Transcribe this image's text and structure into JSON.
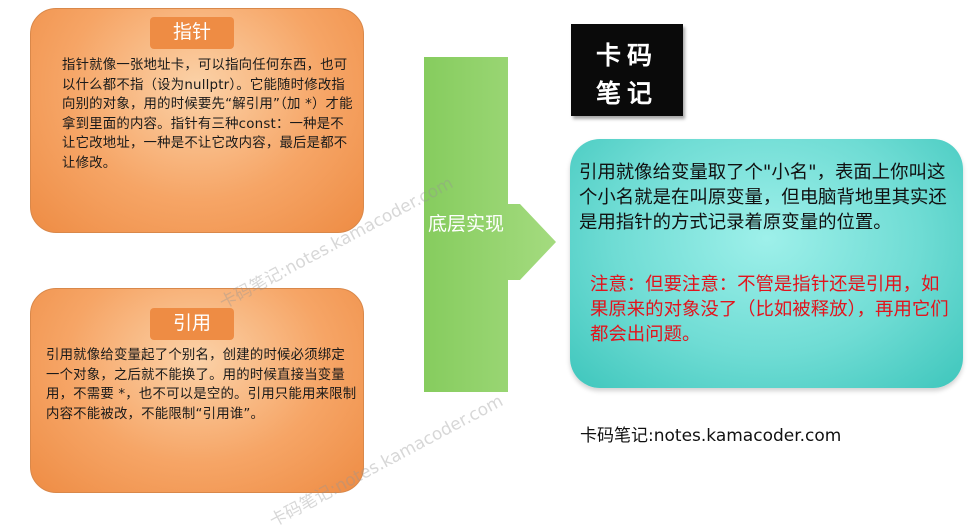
{
  "pointer": {
    "title": "指针",
    "description": "指针就像一张地址卡，可以指向任何东西，也可以什么都不指（设为nullptr）。它能随时修改指向别的对象，用的时候要先“解引用”（加 *）才能拿到里面的内容。指针有三种const：一种是不让它改地址，一种是不让它改内容，最后是都不让修改。"
  },
  "reference": {
    "title": "引用",
    "description": "引用就像给变量起了个别名，创建的时候必须绑定一个对象，之后就不能换了。用的时候直接当变量用，不需要 *，也不可以是空的。引用只能用来限制内容不能被改，不能限制“引用谁”。"
  },
  "arrow": {
    "label": "底层实现",
    "color": "#8fcf6a"
  },
  "logo": {
    "line1": "卡码",
    "line2": "笔记"
  },
  "implementation": {
    "main": "引用就像给变量取了个\"小名\"，表面上你叫这个小名就是在叫原变量，但电脑背地里其实还是用指针的方式记录着原变量的位置。",
    "note": "注意：但要注意：不管是指针还是引用，如果原来的对象没了（比如被释放），再用它们都会出问题。"
  },
  "footer": "卡码笔记:notes.kamacoder.com",
  "watermarks": [
    "卡码笔记:notes.kamacoder.com",
    "卡码笔记:notes.kamacoder.com"
  ],
  "colors": {
    "orange": "#ee8c44",
    "teal": "#6fdcd4",
    "note_red": "#e2141d"
  }
}
